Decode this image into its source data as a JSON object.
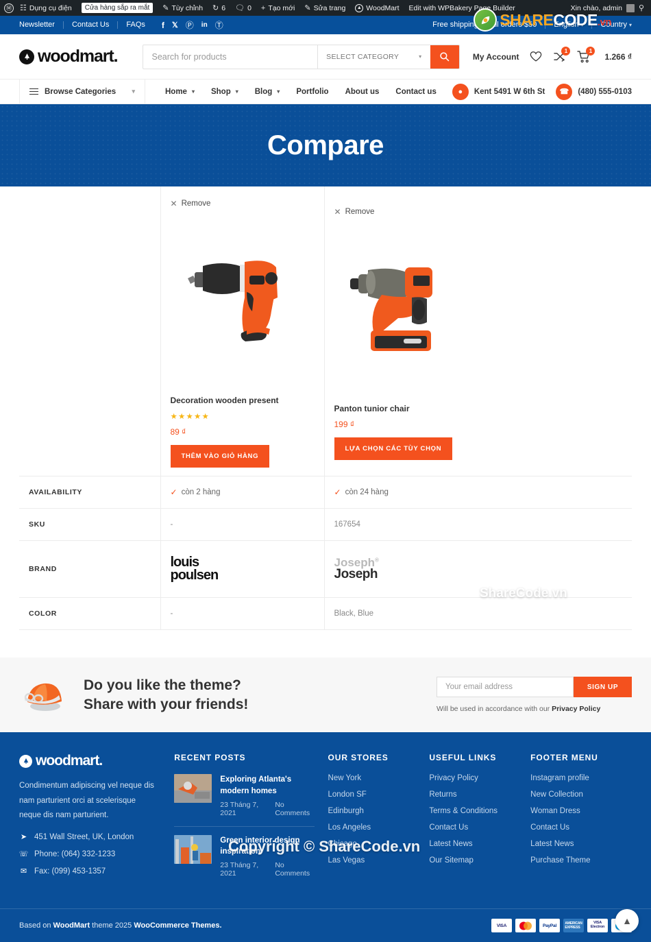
{
  "adminbar": {
    "wp_logo": "wordpress-icon",
    "items": [
      {
        "icon": "dashboard-icon",
        "label": "Dụng cụ điện"
      },
      {
        "icon": "",
        "label": "Cửa hàng sắp ra mắt",
        "pill": true
      },
      {
        "icon": "brush-icon",
        "label": "Tùy chỉnh"
      },
      {
        "icon": "updates-icon",
        "label": "6"
      },
      {
        "icon": "comment-icon",
        "label": "0"
      },
      {
        "icon": "plus-icon",
        "label": "Tạo mới"
      },
      {
        "icon": "pencil-icon",
        "label": "Sửa trang"
      },
      {
        "icon": "woodmart-icon",
        "label": "WoodMart"
      },
      {
        "icon": "",
        "label": "Edit with WPBakery Page Builder"
      }
    ],
    "greeting": "Xin chào, admin",
    "search_icon": "search-icon"
  },
  "topbar": {
    "links": [
      "Newsletter",
      "Contact Us",
      "FAQs"
    ],
    "social": [
      {
        "name": "facebook-icon",
        "glyph": "f"
      },
      {
        "name": "x-twitter-icon",
        "glyph": "✕"
      },
      {
        "name": "pinterest-icon",
        "glyph": "℗"
      },
      {
        "name": "linkedin-icon",
        "glyph": "in"
      },
      {
        "name": "telegram-icon",
        "glyph": "➤"
      }
    ],
    "shipping_note": "Free shipping for all orders $50",
    "language": "English",
    "country": "Country"
  },
  "header": {
    "brand": "woodmart.",
    "search_placeholder": "Search for products",
    "category_label": "SELECT CATEGORY",
    "my_account": "My Account",
    "wishlist_icon": "heart-icon",
    "compare_icon": "compare-icon",
    "compare_count": "1",
    "cart_icon": "cart-icon",
    "cart_count": "1",
    "cart_amount": "1.266 ₫"
  },
  "nav": {
    "browse_categories": "Browse Categories",
    "menu": [
      "Home",
      "Shop",
      "Blog",
      "Portfolio",
      "About us",
      "Contact us"
    ],
    "address": "Kent 5491 W 6th St",
    "phone": "(480) 555-0103"
  },
  "hero": {
    "title": "Compare"
  },
  "compare": {
    "remove_label": "Remove",
    "rows": [
      {
        "label": "AVAILABILITY",
        "type": "stock",
        "values": [
          "còn 2 hàng",
          "còn 24 hàng"
        ]
      },
      {
        "label": "SKU",
        "type": "text",
        "values": [
          "-",
          "167654"
        ]
      },
      {
        "label": "BRAND",
        "type": "brand",
        "values": [
          "louis poulsen",
          "Joseph Joseph"
        ]
      },
      {
        "label": "COLOR",
        "type": "text",
        "values": [
          "-",
          "Black, Blue"
        ]
      }
    ],
    "products": [
      {
        "name": "Decoration wooden present",
        "rating": 5,
        "stars": "★★★★★",
        "price": "89 ₫",
        "button": "THÊM VÀO GIỎ HÀNG",
        "image": "impact-wrench-photo"
      },
      {
        "name": "Panton tunior chair",
        "rating": 0,
        "stars": "",
        "price": "199 ₫",
        "button": "LỰA CHỌN CÁC TÙY CHỌN",
        "image": "cordless-drill-photo"
      }
    ]
  },
  "promo": {
    "line1": "Do you like the theme?",
    "line2": "Share with your friends!",
    "helmet_icon": "safety-helmet-icon",
    "email_placeholder": "Your email address",
    "signup_label": "SIGN UP",
    "note_prefix": "Will be used in accordance with our ",
    "note_link": "Privacy Policy"
  },
  "footer": {
    "brand": "woodmart.",
    "description": "Condimentum adipiscing vel neque dis nam parturient orci at scelerisque neque dis nam parturient.",
    "contacts": [
      {
        "icon": "location-icon",
        "text": "451 Wall Street, UK, London"
      },
      {
        "icon": "phone-icon",
        "text": "Phone: (064) 332-1233"
      },
      {
        "icon": "mail-icon",
        "text": "Fax: (099) 453-1357"
      }
    ],
    "recent_posts_heading": "RECENT POSTS",
    "posts": [
      {
        "title": "Exploring Atlanta's modern homes",
        "date": "23 Tháng 7, 2021",
        "comments": "No Comments"
      },
      {
        "title": "Green interior design inspiration",
        "date": "23 Tháng 7, 2021",
        "comments": "No Comments"
      }
    ],
    "stores_heading": "OUR STORES",
    "stores": [
      "New York",
      "London SF",
      "Edinburgh",
      "Los Angeles",
      "Chicago",
      "Las Vegas"
    ],
    "useful_heading": "USEFUL LINKS",
    "useful": [
      "Privacy Policy",
      "Returns",
      "Terms & Conditions",
      "Contact Us",
      "Latest News",
      "Our Sitemap"
    ],
    "menu_heading": "FOOTER MENU",
    "menu": [
      "Instagram profile",
      "New Collection",
      "Woman Dress",
      "Contact Us",
      "Latest News",
      "Purchase Theme"
    ],
    "copyright_prefix": "Based on ",
    "copyright_brand": "WoodMart",
    "copyright_mid": " theme 2025 ",
    "copyright_suffix": "WooCommerce Themes.",
    "cards": [
      "VISA",
      "MC",
      "PayPal",
      "AMEX",
      "VISA Electron",
      "Maestro"
    ],
    "scroll_top_icon": "chevron-up-icon"
  },
  "watermarks": {
    "share": "SHARE",
    "code": "CODE",
    "vn": ".vn",
    "middle": "ShareCode.vn",
    "copyright": "Copyright © ShareCode.vn"
  },
  "colors": {
    "brand_blue": "#0a4f99",
    "accent_orange": "#f4511e",
    "admin_dark": "#1d2327",
    "star_yellow": "#f7b617"
  }
}
